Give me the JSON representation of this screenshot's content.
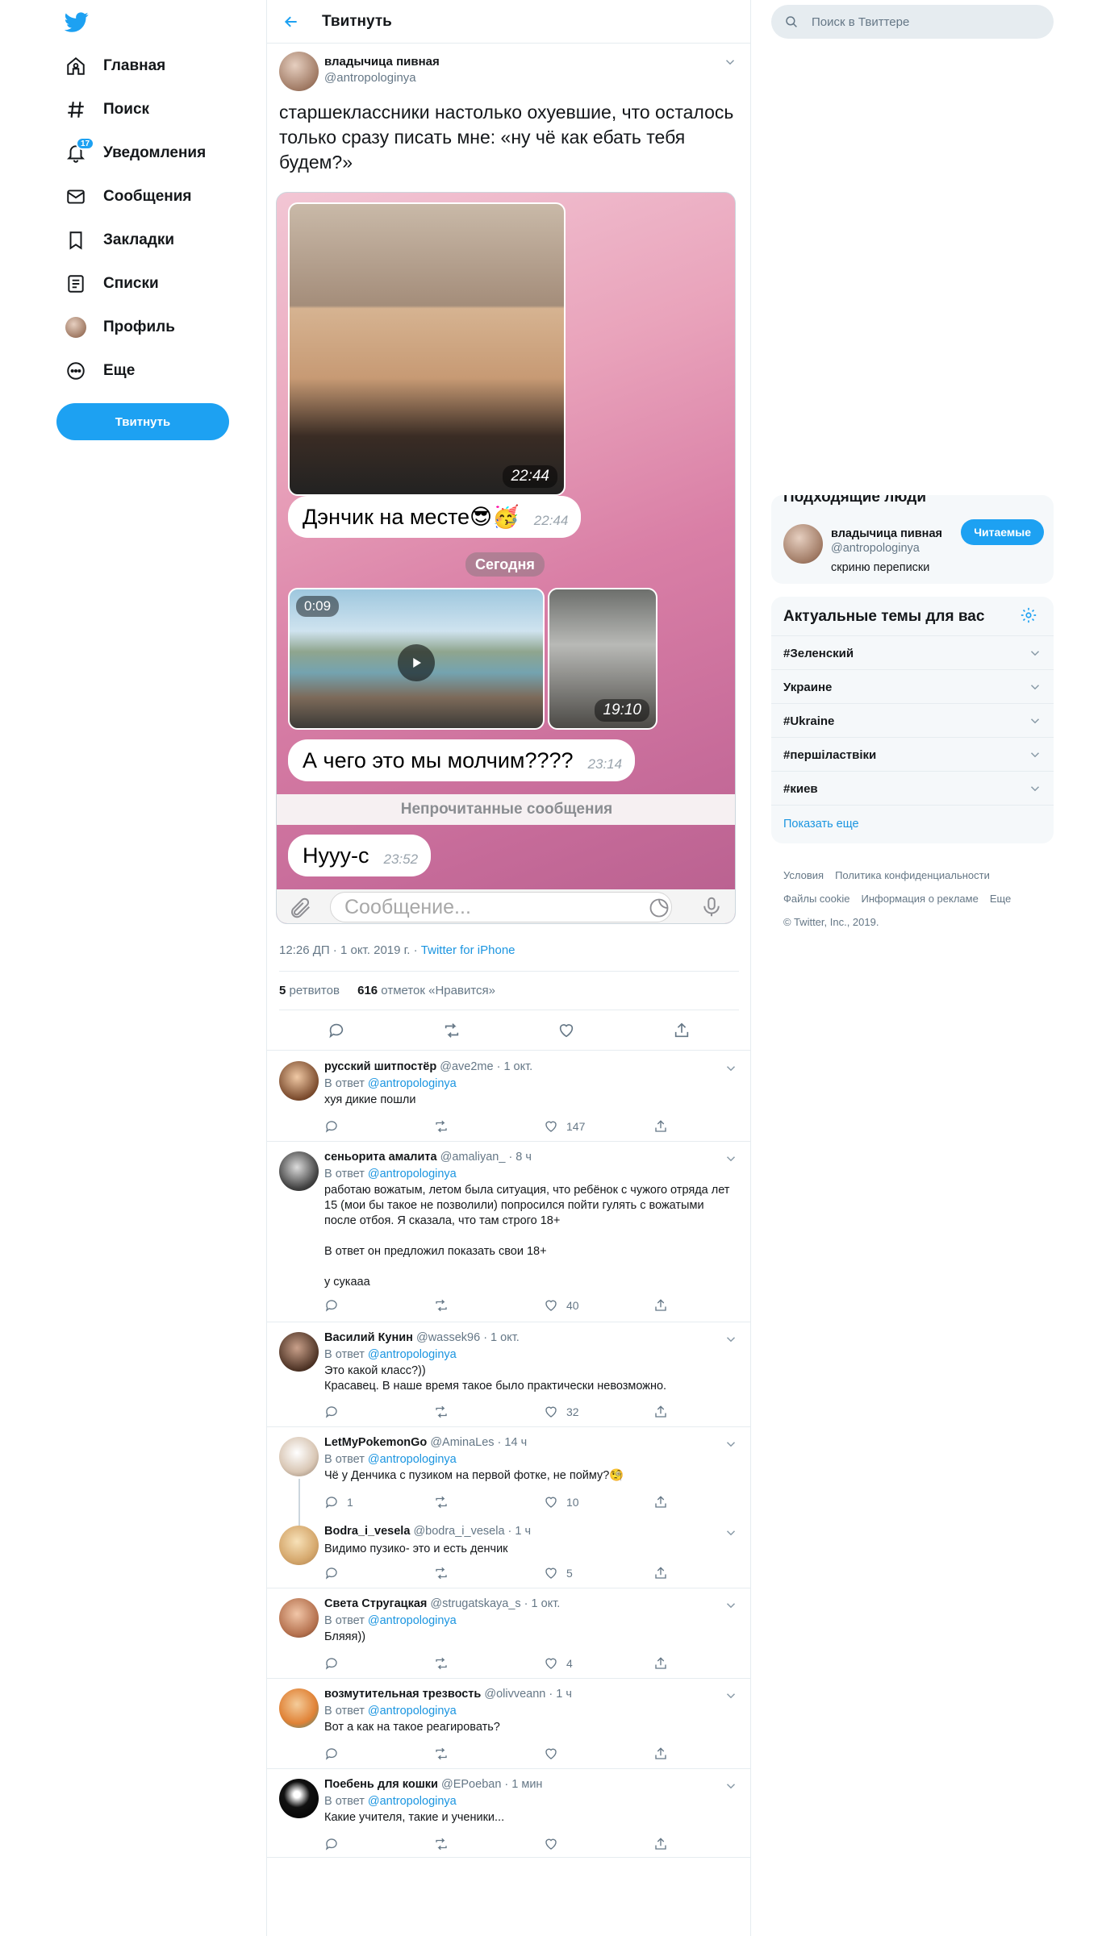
{
  "nav": {
    "items": [
      {
        "label": "Главная",
        "icon": "home-icon"
      },
      {
        "label": "Поиск",
        "icon": "hash-icon"
      },
      {
        "label": "Уведомления",
        "icon": "bell-icon",
        "badge": "17"
      },
      {
        "label": "Сообщения",
        "icon": "mail-icon"
      },
      {
        "label": "Закладки",
        "icon": "bookmark-icon"
      },
      {
        "label": "Списки",
        "icon": "list-icon"
      },
      {
        "label": "Профиль",
        "icon": "avatar"
      },
      {
        "label": "Еще",
        "icon": "more-icon"
      }
    ],
    "tweet_button": "Твитнуть"
  },
  "header": {
    "title": "Твитнуть"
  },
  "tweet": {
    "name": "владычица пивная",
    "handle": "@antropologinya",
    "text": "старшеклассники настолько охуевшие, что осталось только сразу писать мне: «ну чё как ебать тебя будем?»",
    "media": {
      "photo1_time": "22:44",
      "bubble1_text": "Дэнчик на месте😎🥳",
      "bubble1_time": "22:44",
      "date_label": "Сегодня",
      "video_duration": "0:09",
      "photo3_time": "19:10",
      "bubble2_text": "А чего это мы молчим????",
      "bubble2_time": "23:14",
      "unread_label": "Непрочитанные сообщения",
      "bubble3_text": "Нууу-с",
      "bubble3_time": "23:52",
      "input_placeholder": "Сообщение..."
    },
    "meta_time": "12:26 ДП · 1 окт. 2019 г. · ",
    "meta_source": "Twitter for iPhone",
    "retweets_count": "5",
    "retweets_label": " ретвитов",
    "likes_count": "616",
    "likes_label": " отметок «Нравится»"
  },
  "reply_prefix": "В ответ ",
  "replies": [
    {
      "name": "русский шитпостёр",
      "meta": "@ave2me · 1 окт.",
      "to": "@antropologinya",
      "text": "хуя дикие пошли",
      "replies": "",
      "likes": "147"
    },
    {
      "name": "сеньорита амалита",
      "meta": "@amaliyan_ · 8 ч",
      "to": "@antropologinya",
      "text": "работаю вожатым, летом была ситуация, что ребёнок с чужого отряда лет 15 (мои бы такое не позволили) попросился пойти гулять с вожатыми после отбоя. Я сказала, что там строго 18+\n\nВ ответ он предложил показать свои 18+\n\nу сукааа",
      "replies": "",
      "likes": "40"
    },
    {
      "name": "Василий Кунин",
      "meta": "@wassek96 · 1 окт.",
      "to": "@antropologinya",
      "text": "Это какой класс?))\nКрасавец. В наше время такое было практически невозможно.",
      "replies": "",
      "likes": "32"
    },
    {
      "name": "LetMyPokemonGo",
      "meta": "@AminaLes · 14 ч",
      "to": "@antropologinya",
      "text": "Чё у Денчика с пузиком на первой фотке, не пойму?🧐",
      "replies": "1",
      "likes": "10"
    },
    {
      "name": "Bodra_i_vesela",
      "meta": "@bodra_i_vesela · 1 ч",
      "to": "",
      "text": "Видимо пузико- это и есть денчик",
      "replies": "",
      "likes": "5"
    },
    {
      "name": "Света Стругацкая",
      "meta": "@strugatskaya_s · 1 окт.",
      "to": "@antropologinya",
      "text": "Бляяя))",
      "replies": "",
      "likes": "4"
    },
    {
      "name": "возмутительная трезвость",
      "meta": "@olivveann · 1 ч",
      "to": "@antropologinya",
      "text": "Вот а как на такое реагировать?",
      "replies": "",
      "likes": ""
    },
    {
      "name": "Поебень для кошки",
      "meta": "@EPoeban · 1 мин",
      "to": "@antropologinya",
      "text": "Какие учителя, такие и ученики...",
      "replies": "",
      "likes": ""
    }
  ],
  "right": {
    "search_placeholder": "Поиск в Твиттере",
    "who_to_follow": {
      "title": "Подходящие люди",
      "name": "владычица пивная",
      "handle": "@antropologinya",
      "bio": "скриню переписки",
      "button": "Читаемые"
    },
    "trends": {
      "title": "Актуальные темы для вас",
      "items": [
        "#Зеленский",
        "Украине",
        "#Ukraine",
        "#першіластвіки",
        "#киев"
      ],
      "show_more": "Показать еще"
    },
    "footer": {
      "links1": [
        "Условия",
        "Политика конфиденциальности"
      ],
      "links2": [
        "Файлы cookie",
        "Информация о рекламе",
        "Еще"
      ],
      "copyright": "© Twitter, Inc., 2019."
    }
  },
  "colors": {
    "accent": "#1da1f2",
    "link": "#1b95e0",
    "grey": "#657786",
    "border": "#e6ecf0"
  }
}
